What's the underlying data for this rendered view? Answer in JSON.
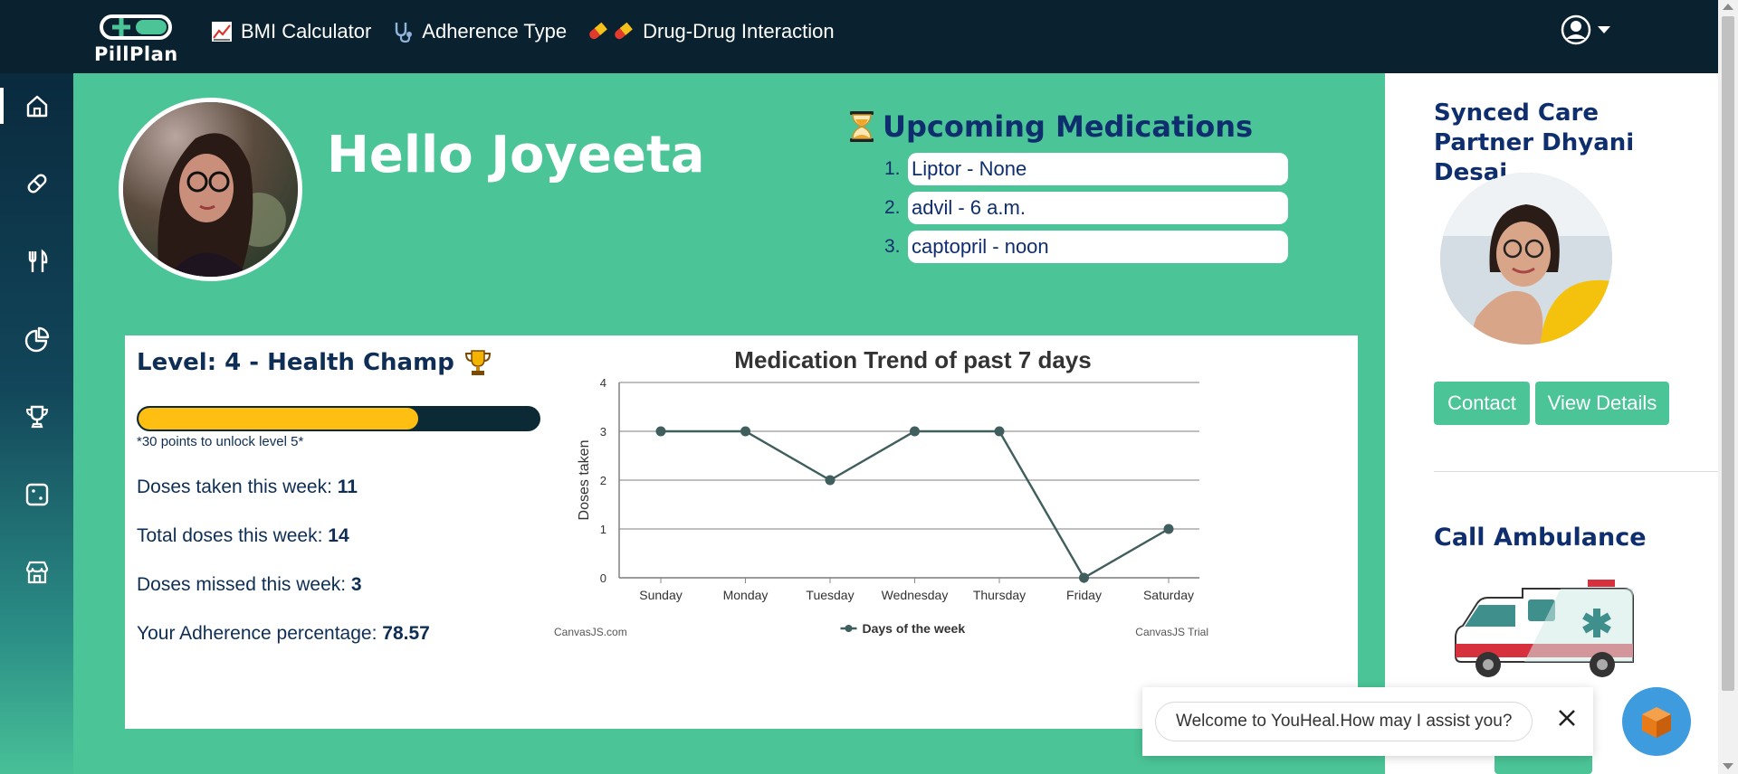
{
  "brand": {
    "name": "PillPlan"
  },
  "topnav": [
    {
      "label": "BMI Calculator",
      "icon": "chart-icon"
    },
    {
      "label": "Adherence Type",
      "icon": "stethoscope-icon"
    },
    {
      "label": "Drug-Drug Interaction",
      "icon": "pills-icon"
    }
  ],
  "sidebar": [
    {
      "icon": "home-icon",
      "active": true
    },
    {
      "icon": "pill-icon"
    },
    {
      "icon": "fork-knife-icon"
    },
    {
      "icon": "pie-chart-icon"
    },
    {
      "icon": "trophy-icon"
    },
    {
      "icon": "dice-icon"
    },
    {
      "icon": "store-icon"
    }
  ],
  "greeting": "Hello Joyeeta",
  "upcoming": {
    "title": "Upcoming Medications",
    "items": [
      {
        "num": "1.",
        "text": "Liptor - None"
      },
      {
        "num": "2.",
        "text": "advil - 6 a.m."
      },
      {
        "num": "3.",
        "text": "captopril - noon"
      }
    ]
  },
  "level": {
    "title": "Level: 4 - Health Champ",
    "progress_fraction": 0.7,
    "unlock_text": "*30 points to unlock level 5*"
  },
  "stats": [
    {
      "label": "Doses taken this week: ",
      "value": "11"
    },
    {
      "label": "Total doses this week: ",
      "value": "14"
    },
    {
      "label": "Doses missed this week: ",
      "value": "3"
    },
    {
      "label": "Your Adherence percentage: ",
      "value": "78.57"
    }
  ],
  "chart_data": {
    "type": "line",
    "title": "Medication Trend of past 7 days",
    "xlabel": "",
    "ylabel": "Doses taken",
    "categories": [
      "Sunday",
      "Monday",
      "Tuesday",
      "Wednesday",
      "Thursday",
      "Friday",
      "Saturday"
    ],
    "series": [
      {
        "name": "Days of the week",
        "values": [
          3,
          3,
          2,
          3,
          3,
          0,
          1
        ],
        "color": "#3f5e5d"
      }
    ],
    "ylim": [
      0,
      4
    ],
    "yticks": [
      0,
      1,
      2,
      3,
      4
    ],
    "grid": true,
    "legend": "bottom",
    "credit_left": "CanvasJS.com",
    "credit_right": "CanvasJS Trial"
  },
  "care_partner": {
    "title": "Synced Care Partner Dhyani Desai",
    "contact_label": "Contact",
    "details_label": "View Details"
  },
  "ambulance": {
    "title": "Call Ambulance"
  },
  "chat": {
    "message": "Welcome to YouHeal.How may I assist you?"
  },
  "colors": {
    "primary_green": "#4bc497",
    "navy": "#0a2230",
    "heading": "#0e2e6e",
    "progress": "#ffbe12"
  }
}
